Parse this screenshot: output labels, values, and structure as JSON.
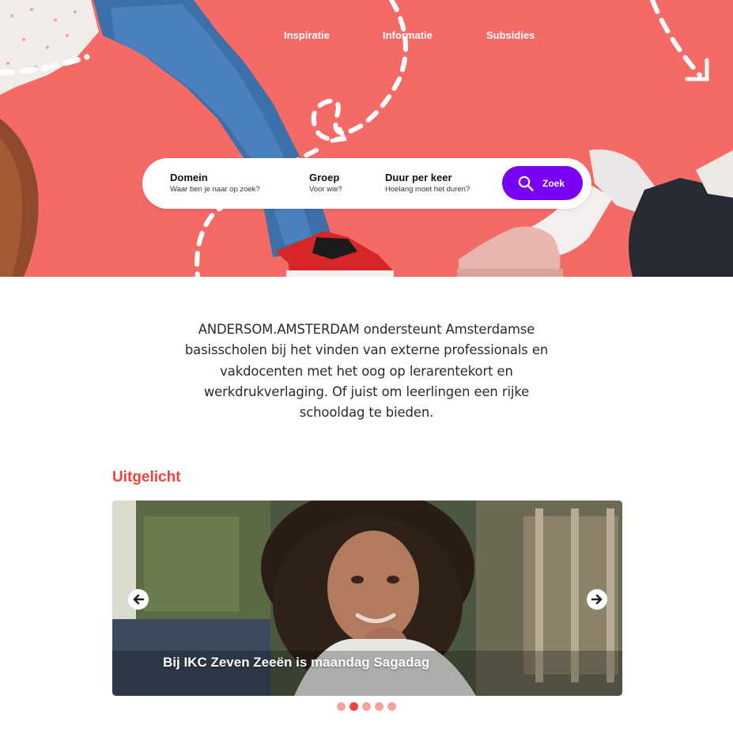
{
  "colors": {
    "hero_background": "#f46a66",
    "search_button": "#7a00f5",
    "accent_red": "#f0453c",
    "dot_inactive": "#f6a39d"
  },
  "nav": {
    "items": [
      {
        "label": "Inspiratie"
      },
      {
        "label": "Informatie"
      },
      {
        "label": "Subsidies"
      }
    ]
  },
  "search": {
    "fields": [
      {
        "title": "Domein",
        "subtitle": "Waar ben je naar op zoek?"
      },
      {
        "title": "Groep",
        "subtitle": "Voor wie?"
      },
      {
        "title": "Duur per keer",
        "subtitle": "Hoelang moet het duren?"
      }
    ],
    "button_label": "Zoek",
    "button_icon": "search-icon"
  },
  "intro": {
    "text": "ANDERSOM.AMSTERDAM ondersteunt Amsterdamse basisscholen bij het vinden van externe professionals en vakdocenten met het oog op lerarentekort en werkdrukverlaging. Of juist om leerlingen een rijke schooldag te bieden."
  },
  "featured": {
    "heading": "Uitgelicht",
    "slide_caption": "Bij IKC Zeven Zeeën is maandag Sagadag",
    "slide_count": 5,
    "active_slide": 2
  }
}
